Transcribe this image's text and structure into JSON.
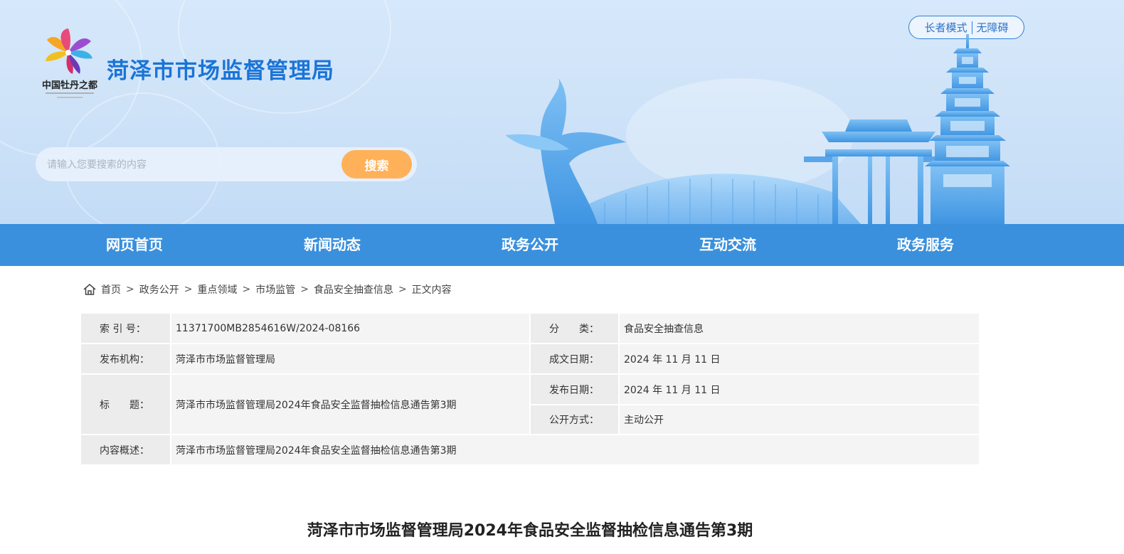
{
  "header": {
    "site_title": "菏泽市市场监督管理局",
    "logo_text": "中国牡丹之都",
    "mode_links": [
      "长者模式",
      "无障碍"
    ],
    "search": {
      "placeholder": "请输入您要搜索的内容",
      "button_label": "搜索"
    }
  },
  "nav": {
    "items": [
      "网页首页",
      "新闻动态",
      "政务公开",
      "互动交流",
      "政务服务"
    ]
  },
  "breadcrumb": {
    "items": [
      "首页",
      "政务公开",
      "重点领域",
      "市场监管",
      "食品安全抽查信息",
      "正文内容"
    ],
    "separator": ">"
  },
  "meta": {
    "index_label": "索 引 号：",
    "index_value": "11371700MB2854616W/2024-08166",
    "category_label": "分　　类：",
    "category_value": "食品安全抽查信息",
    "publisher_label": "发布机构：",
    "publisher_value": "菏泽市市场监督管理局",
    "written_date_label": "成文日期：",
    "written_date_value": "2024 年 11 月 11 日",
    "title_label": "标　　题：",
    "title_value": "菏泽市市场监督管理局2024年食品安全监督抽检信息通告第3期",
    "publish_date_label": "发布日期：",
    "publish_date_value": "2024 年 11 月 11 日",
    "disclosure_label": "公开方式：",
    "disclosure_value": "主动公开",
    "summary_label": "内容概述：",
    "summary_value": "菏泽市市场监督管理局2024年食品安全监督抽检信息通告第3期"
  },
  "article": {
    "title": "菏泽市市场监督管理局2024年食品安全监督抽检信息通告第3期"
  },
  "colors": {
    "brand_blue": "#1a74d6",
    "nav_bg": "#3a90dc",
    "search_button": "#ffb15a"
  }
}
